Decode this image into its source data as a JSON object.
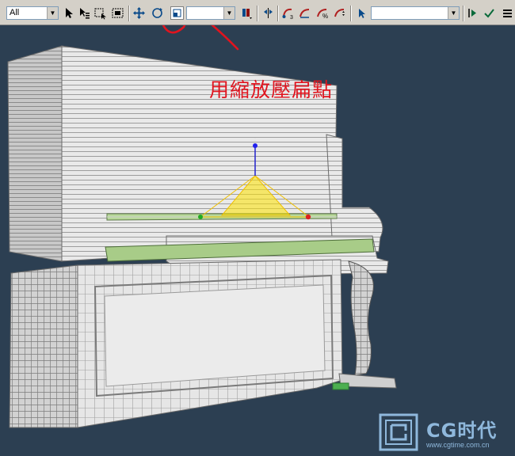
{
  "toolbar": {
    "selection_filter": {
      "value": "All"
    },
    "reference_coord": {
      "value": ""
    },
    "named_selection": {
      "value": ""
    },
    "icons": [
      "select-object-icon",
      "select-by-name-icon",
      "rectangular-selection-icon",
      "window-crossing-icon",
      "move-icon",
      "rotate-icon",
      "scale-icon",
      "pivot-center-icon",
      "mirror-icon",
      "align-icon",
      "snap-icon",
      "angle-snap-icon",
      "percent-snap-icon",
      "spinner-snap-icon",
      "edit-named-selection-icon",
      "curve-editor-icon",
      "check-icon",
      "layers-icon"
    ]
  },
  "annotation": {
    "text": "用縮放壓扁點",
    "color": "#e0141e"
  },
  "watermark": {
    "brand": "CG时代",
    "url": "www.cgtime.com.cn"
  },
  "colors": {
    "viewport_bg": "#2c3f52",
    "toolbar_bg": "#d4d0c8",
    "gizmo": "#ffe400"
  }
}
